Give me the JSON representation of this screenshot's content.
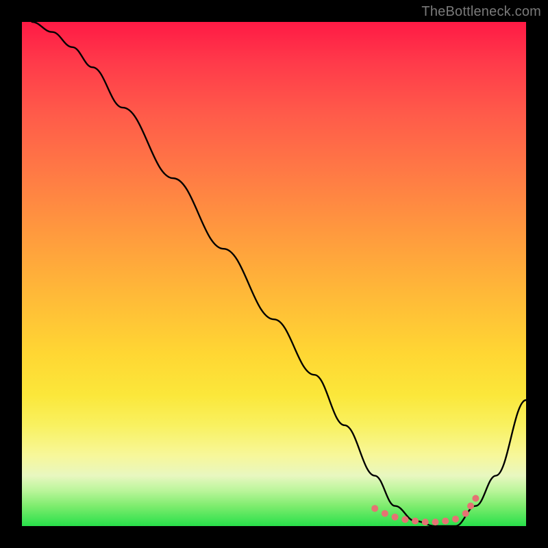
{
  "watermark": "TheBottleneck.com",
  "chart_data": {
    "type": "line",
    "title": "",
    "xlabel": "",
    "ylabel": "",
    "xlim": [
      0,
      100
    ],
    "ylim": [
      0,
      100
    ],
    "grid": false,
    "legend": false,
    "background_gradient": {
      "direction": "vertical",
      "stops": [
        {
          "pct": 0,
          "color": "#ff1a45"
        },
        {
          "pct": 30,
          "color": "#ff7a45"
        },
        {
          "pct": 66,
          "color": "#ffd733"
        },
        {
          "pct": 86,
          "color": "#f7f79a"
        },
        {
          "pct": 100,
          "color": "#28e04a"
        }
      ]
    },
    "series": [
      {
        "name": "bottleneck-curve",
        "stroke": "#000000",
        "x": [
          2,
          6,
          10,
          14,
          20,
          30,
          40,
          50,
          58,
          64,
          70,
          74,
          78,
          82,
          86,
          90,
          94,
          100
        ],
        "values": [
          100,
          98,
          95,
          91,
          83,
          69,
          55,
          41,
          30,
          20,
          10,
          4,
          1,
          0,
          0,
          4,
          10,
          25
        ]
      }
    ],
    "markers": {
      "name": "highlight-dots",
      "color": "#e57373",
      "x": [
        70,
        72,
        74,
        76,
        78,
        80,
        82,
        84,
        86,
        88,
        89,
        90
      ],
      "values": [
        3.5,
        2.5,
        1.8,
        1.3,
        1.0,
        0.8,
        0.8,
        1.0,
        1.4,
        2.5,
        4.0,
        5.5
      ]
    }
  }
}
